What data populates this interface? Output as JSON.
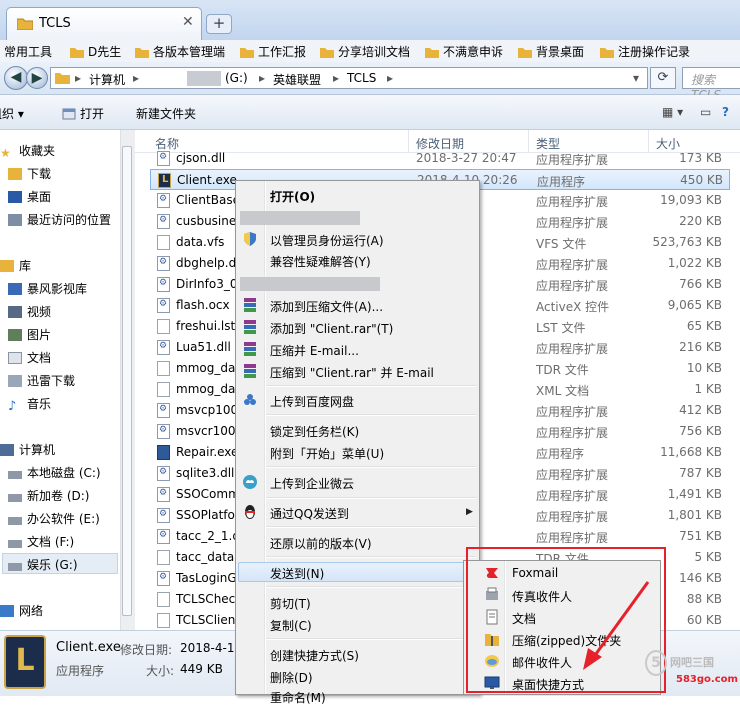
{
  "window": {
    "tab_title": "TCLS",
    "tab_close": "✕",
    "new_tab": "+"
  },
  "bookmarks": [
    {
      "label": "常用工具"
    },
    {
      "label": "D先生"
    },
    {
      "label": "各版本管理端"
    },
    {
      "label": "工作汇报"
    },
    {
      "label": "分享培训文档"
    },
    {
      "label": "不满意申诉"
    },
    {
      "label": "背景桌面"
    },
    {
      "label": "注册操作记录"
    }
  ],
  "address": {
    "crumbs": [
      "计算机",
      "(G:)",
      "英雄联盟",
      "TCLS"
    ],
    "search_placeholder": "搜索 TCLS"
  },
  "toolbar": {
    "organize": "组织 ▾",
    "open": "打开",
    "new_folder": "新建文件夹"
  },
  "nav": {
    "favorites": "收藏夹",
    "favorites_items": [
      "下载",
      "桌面",
      "最近访问的位置"
    ],
    "library": "库",
    "library_items": [
      "暴风影视库",
      "视频",
      "图片",
      "文档",
      "迅雷下载",
      "音乐"
    ],
    "computer": "计算机",
    "drives": [
      "本地磁盘 (C:)",
      "新加卷 (D:)",
      "办公软件 (E:)",
      "文档 (F:)",
      "娱乐 (G:)"
    ],
    "network": "网络"
  },
  "columns": {
    "name": "名称",
    "date": "修改日期",
    "type": "类型",
    "size": "大小"
  },
  "files": [
    {
      "name": "cjson.dll",
      "date": "2018-3-27 20:47",
      "type": "应用程序扩展",
      "size": "173 KB",
      "icon": "dll"
    },
    {
      "name": "Client.exe",
      "date": "2018-4-10 20:26",
      "type": "应用程序",
      "size": "450 KB",
      "icon": "exe"
    },
    {
      "name": "ClientBase",
      "date": "20:26",
      "type": "应用程序扩展",
      "size": "19,093 KB",
      "icon": "dll"
    },
    {
      "name": "cusbusine",
      "date": "20:47",
      "type": "应用程序扩展",
      "size": "220 KB",
      "icon": "dll"
    },
    {
      "name": "data.vfs",
      "date": "15:50",
      "type": "VFS 文件",
      "size": "523,763 KB",
      "icon": "file"
    },
    {
      "name": "dbghelp.d",
      "date": "20:47",
      "type": "应用程序扩展",
      "size": "1,022 KB",
      "icon": "dll"
    },
    {
      "name": "DirInfo3_0",
      "date": "20:47",
      "type": "应用程序扩展",
      "size": "766 KB",
      "icon": "dll"
    },
    {
      "name": "flash.ocx",
      "date": "11:26",
      "type": "ActiveX 控件",
      "size": "9,065 KB",
      "icon": "dll"
    },
    {
      "name": "freshui.lst",
      "date": "8:25",
      "type": "LST 文件",
      "size": "65 KB",
      "icon": "file"
    },
    {
      "name": "Lua51.dll",
      "date": "20:47",
      "type": "应用程序扩展",
      "size": "216 KB",
      "icon": "dll"
    },
    {
      "name": "mmog_da",
      "date": "7:41",
      "type": "TDR 文件",
      "size": "10 KB",
      "icon": "file"
    },
    {
      "name": "mmog_da",
      "date": "17:32",
      "type": "XML 文档",
      "size": "1 KB",
      "icon": "file"
    },
    {
      "name": "msvcp100",
      "date": "23:03",
      "type": "应用程序扩展",
      "size": "412 KB",
      "icon": "dll"
    },
    {
      "name": "msvcr100.",
      "date": "0:40",
      "type": "应用程序扩展",
      "size": "756 KB",
      "icon": "dll"
    },
    {
      "name": "Repair.exe",
      "date": "17:36",
      "type": "应用程序",
      "size": "11,668 KB",
      "icon": "rep"
    },
    {
      "name": "sqlite3.dll",
      "date": "20:47",
      "type": "应用程序扩展",
      "size": "787 KB",
      "icon": "dll"
    },
    {
      "name": "SSOComm",
      "date": "11:02",
      "type": "应用程序扩展",
      "size": "1,491 KB",
      "icon": "dll"
    },
    {
      "name": "SSOPlatfo",
      "date": "11:02",
      "type": "应用程序扩展",
      "size": "1,801 KB",
      "icon": "dll"
    },
    {
      "name": "tacc_2_1.d",
      "date": "20:47",
      "type": "应用程序扩展",
      "size": "751 KB",
      "icon": "dll"
    },
    {
      "name": "tacc_data",
      "date": "7:41",
      "type": "TDR 文件",
      "size": "5 KB",
      "icon": "file"
    },
    {
      "name": "TasLoginG",
      "date": "20:47",
      "type": "应用程序扩展",
      "size": "146 KB",
      "icon": "dll"
    },
    {
      "name": "TCLSCheck",
      "date": "20:47",
      "type": "应用程序扩展",
      "size": "88 KB",
      "icon": "file"
    },
    {
      "name": "TCLSClient",
      "date": "20:47",
      "type": "应用程序扩展",
      "size": "60 KB",
      "icon": "file"
    }
  ],
  "details": {
    "name": "Client.exe",
    "date_label": "修改日期:",
    "date_value": "2018-4-10",
    "type": "应用程序",
    "size_label": "大小:",
    "size_value": "449 KB"
  },
  "context_menu": {
    "open": "打开(O)",
    "run_as_admin": "以管理员身份运行(A)",
    "compat": "兼容性疑难解答(Y)",
    "add_archive": "添加到压缩文件(A)...",
    "add_rar": "添加到 \"Client.rar\"(T)",
    "compress_email": "压缩并 E-mail...",
    "compress_rar_email": "压缩到 \"Client.rar\" 并 E-mail",
    "baidu": "上传到百度网盘",
    "pin_taskbar": "锁定到任务栏(K)",
    "pin_start": "附到「开始」菜单(U)",
    "wework": "上传到企业微云",
    "qq_send": "通过QQ发送到",
    "restore": "还原以前的版本(V)",
    "send_to": "发送到(N)",
    "cut": "剪切(T)",
    "copy": "复制(C)",
    "create_shortcut": "创建快捷方式(S)",
    "delete": "删除(D)",
    "rename": "重命名(M)"
  },
  "send_to_menu": {
    "foxmail": "Foxmail",
    "fax": "传真收件人",
    "documents": "文档",
    "zip": "压缩(zipped)文件夹",
    "mail": "邮件收件人",
    "desktop": "桌面快捷方式"
  },
  "watermark": {
    "brand": "网吧三国",
    "url": "583go.com"
  },
  "colors": {
    "highlight": "#d5e5f8",
    "annotation": "#e6212a",
    "folder": "#e8b33a"
  }
}
